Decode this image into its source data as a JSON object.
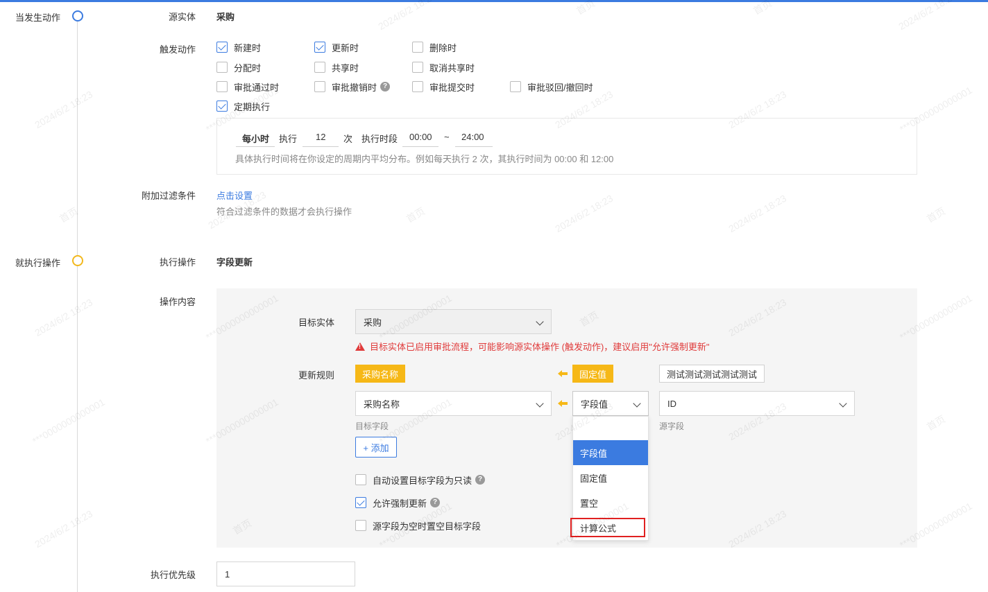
{
  "timeline": {
    "when_label": "当发生动作",
    "then_label": "就执行操作"
  },
  "source_entity": {
    "label": "源实体",
    "value": "采购"
  },
  "trigger": {
    "label": "触发动作",
    "options": [
      {
        "label": "新建时",
        "checked": true
      },
      {
        "label": "更新时",
        "checked": true
      },
      {
        "label": "删除时",
        "checked": false
      },
      {
        "label": "分配时",
        "checked": false
      },
      {
        "label": "共享时",
        "checked": false
      },
      {
        "label": "取消共享时",
        "checked": false
      },
      {
        "label": "审批通过时",
        "checked": false
      },
      {
        "label": "审批撤销时",
        "checked": false
      },
      {
        "label": "审批提交时",
        "checked": false
      },
      {
        "label": "审批驳回/撤回时",
        "checked": false
      },
      {
        "label": "定期执行",
        "checked": true
      }
    ],
    "help_glyph": "?"
  },
  "schedule": {
    "period": "每小时",
    "exec_label": "执行",
    "count": "12",
    "times_label": "次",
    "period_label": "执行时段",
    "start": "00:00",
    "tilde": "~",
    "end": "24:00",
    "hint": "具体执行时间将在你设定的周期内平均分布。例如每天执行 2 次，其执行时间为 00:00 和 12:00"
  },
  "filter": {
    "label": "附加过滤条件",
    "link": "点击设置",
    "hint": "符合过滤条件的数据才会执行操作"
  },
  "operation": {
    "label": "执行操作",
    "value": "字段更新"
  },
  "content": {
    "label": "操作内容",
    "target_entity_label": "目标实体",
    "target_entity_value": "采购",
    "warning": "目标实体已启用审批流程，可能影响源实体操作 (触发动作)，建议启用\"允许强制更新\"",
    "rule_label": "更新规则",
    "tag_target": "采购名称",
    "tag_mode": "固定值",
    "fixed_value_btn": "测试测试测试测试测试",
    "target_field_value": "采购名称",
    "target_field_caption": "目标字段",
    "mode_value": "字段值",
    "source_field_value": "ID",
    "source_field_caption": "源字段",
    "add_btn": "+ 添加",
    "checks": [
      {
        "label": "自动设置目标字段为只读",
        "checked": false,
        "help": true
      },
      {
        "label": "允许强制更新",
        "checked": true,
        "help": true
      },
      {
        "label": "源字段为空时置空目标字段",
        "checked": false,
        "help": false
      }
    ],
    "dropdown": [
      "字段值",
      "固定值",
      "置空",
      "计算公式"
    ]
  },
  "priority": {
    "label": "执行优先级",
    "value": "1"
  },
  "watermark": {
    "date": "2024/6/2 18:23",
    "id": "***0000000000001",
    "home": "首页"
  },
  "colors": {
    "primary": "#3b7be0",
    "accent": "#f6b817",
    "danger": "#e03a3a"
  }
}
